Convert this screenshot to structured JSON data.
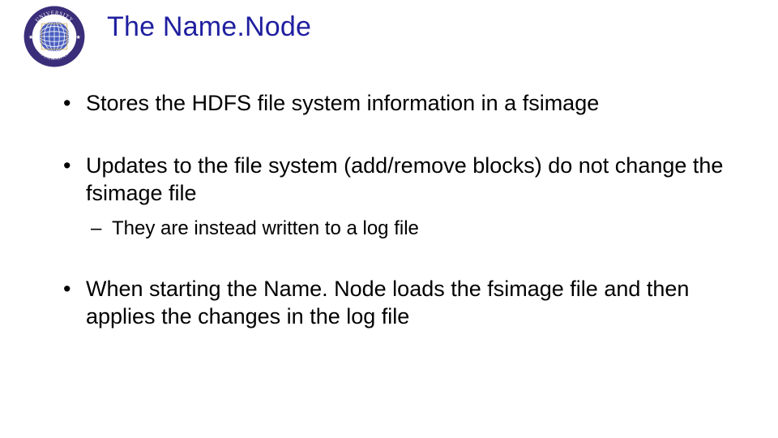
{
  "title": "The Name.Node",
  "logo": {
    "top_text": "UNIVERSITY",
    "bottom_text": "ISLAMABAD",
    "side_text": "COMSATS"
  },
  "bullets": [
    {
      "text": "Stores the HDFS file system information in a fsimage",
      "children": []
    },
    {
      "text": "Updates to the file system (add/remove blocks) do not change the fsimage file",
      "children": [
        {
          "text": "They are instead written to a log file"
        }
      ]
    },
    {
      "text": "When starting the Name. Node loads the fsimage file and then applies the changes in the log file",
      "children": []
    }
  ]
}
